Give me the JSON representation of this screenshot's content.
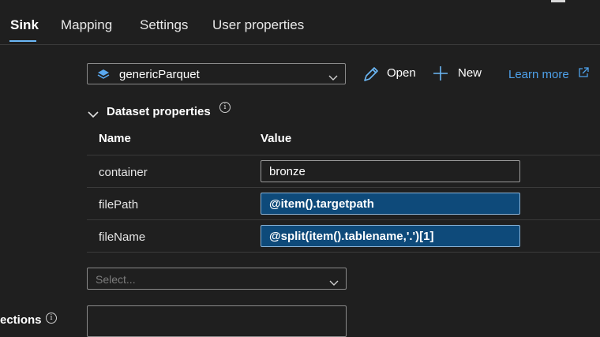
{
  "tabs": [
    {
      "label": "Sink",
      "active": true
    },
    {
      "label": "Mapping",
      "active": false
    },
    {
      "label": "Settings",
      "active": false
    },
    {
      "label": "User properties",
      "active": false
    }
  ],
  "dataset": {
    "selected_value": "genericParquet",
    "icon": "parquet-dataset-icon"
  },
  "toolbar": {
    "open_label": "Open",
    "new_label": "New",
    "learn_more_label": "Learn more"
  },
  "dataset_properties": {
    "title": "Dataset properties",
    "columns": [
      "Name",
      "Value"
    ],
    "rows": [
      {
        "name": "container",
        "value": "bronze",
        "dynamic": false
      },
      {
        "name": "filePath",
        "value": "@item().targetpath",
        "dynamic": true
      },
      {
        "name": "fileName",
        "value": "@split(item().tablename,'.')[1]",
        "dynamic": true
      }
    ]
  },
  "secondary_select": {
    "placeholder": "Select..."
  },
  "bottom_section": {
    "label": "ections"
  },
  "colors": {
    "background": "#1f1f1f",
    "accent": "#6cb8f6",
    "link": "#4ea1ea",
    "dynamic_value_bg": "#0e4a7a"
  }
}
